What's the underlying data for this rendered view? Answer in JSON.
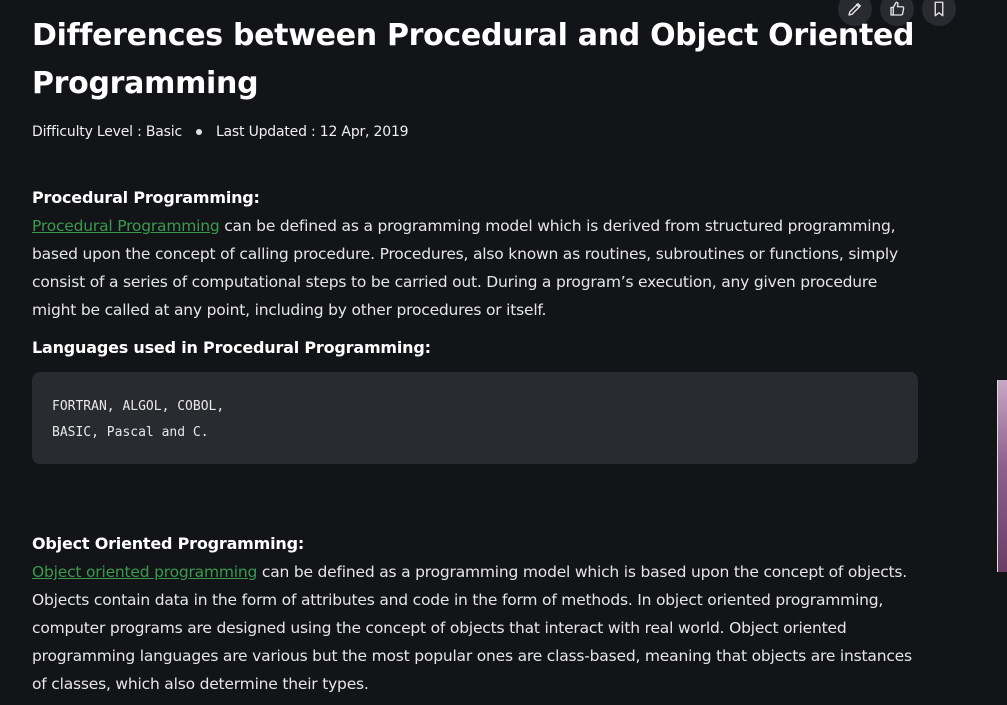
{
  "toolbar": {
    "icons": [
      "pencil-icon",
      "thumbs-up-icon",
      "bookmark-icon"
    ]
  },
  "article": {
    "title": "Differences between Procedural and Object Oriented Programming",
    "difficulty": "Difficulty Level : Basic",
    "last_updated": "Last Updated : 12 Apr, 2019",
    "procedural": {
      "heading": "Procedural Programming:",
      "link_text": "Procedural Programming",
      "body": " can be defined as a programming model which is derived from structured programming, based upon the concept of calling procedure. Procedures, also known as routines, subroutines or functions, simply consist of a series of computational steps to be carried out. During a program’s execution, any given procedure might be called at any point, including by other procedures or itself."
    },
    "languages": {
      "heading": "Languages used in Procedural Programming:",
      "code_line_1": "FORTRAN, ALGOL, COBOL,",
      "code_line_2": "BASIC, Pascal and C."
    },
    "oop": {
      "heading": "Object Oriented Programming:",
      "link_text": "Object oriented programming",
      "body": " can be defined as a programming model which is based upon the concept of objects. Objects contain data in the form of attributes and code in the form of methods. In object oriented programming, computer programs are designed using the concept of objects that interact with real world. Object oriented programming languages are various but the most popular ones are class-based, meaning that objects are instances of classes, which also determine their types."
    }
  },
  "colors": {
    "background": "#131417",
    "link": "#3a9a4e",
    "code_bg": "#2a2b30"
  }
}
